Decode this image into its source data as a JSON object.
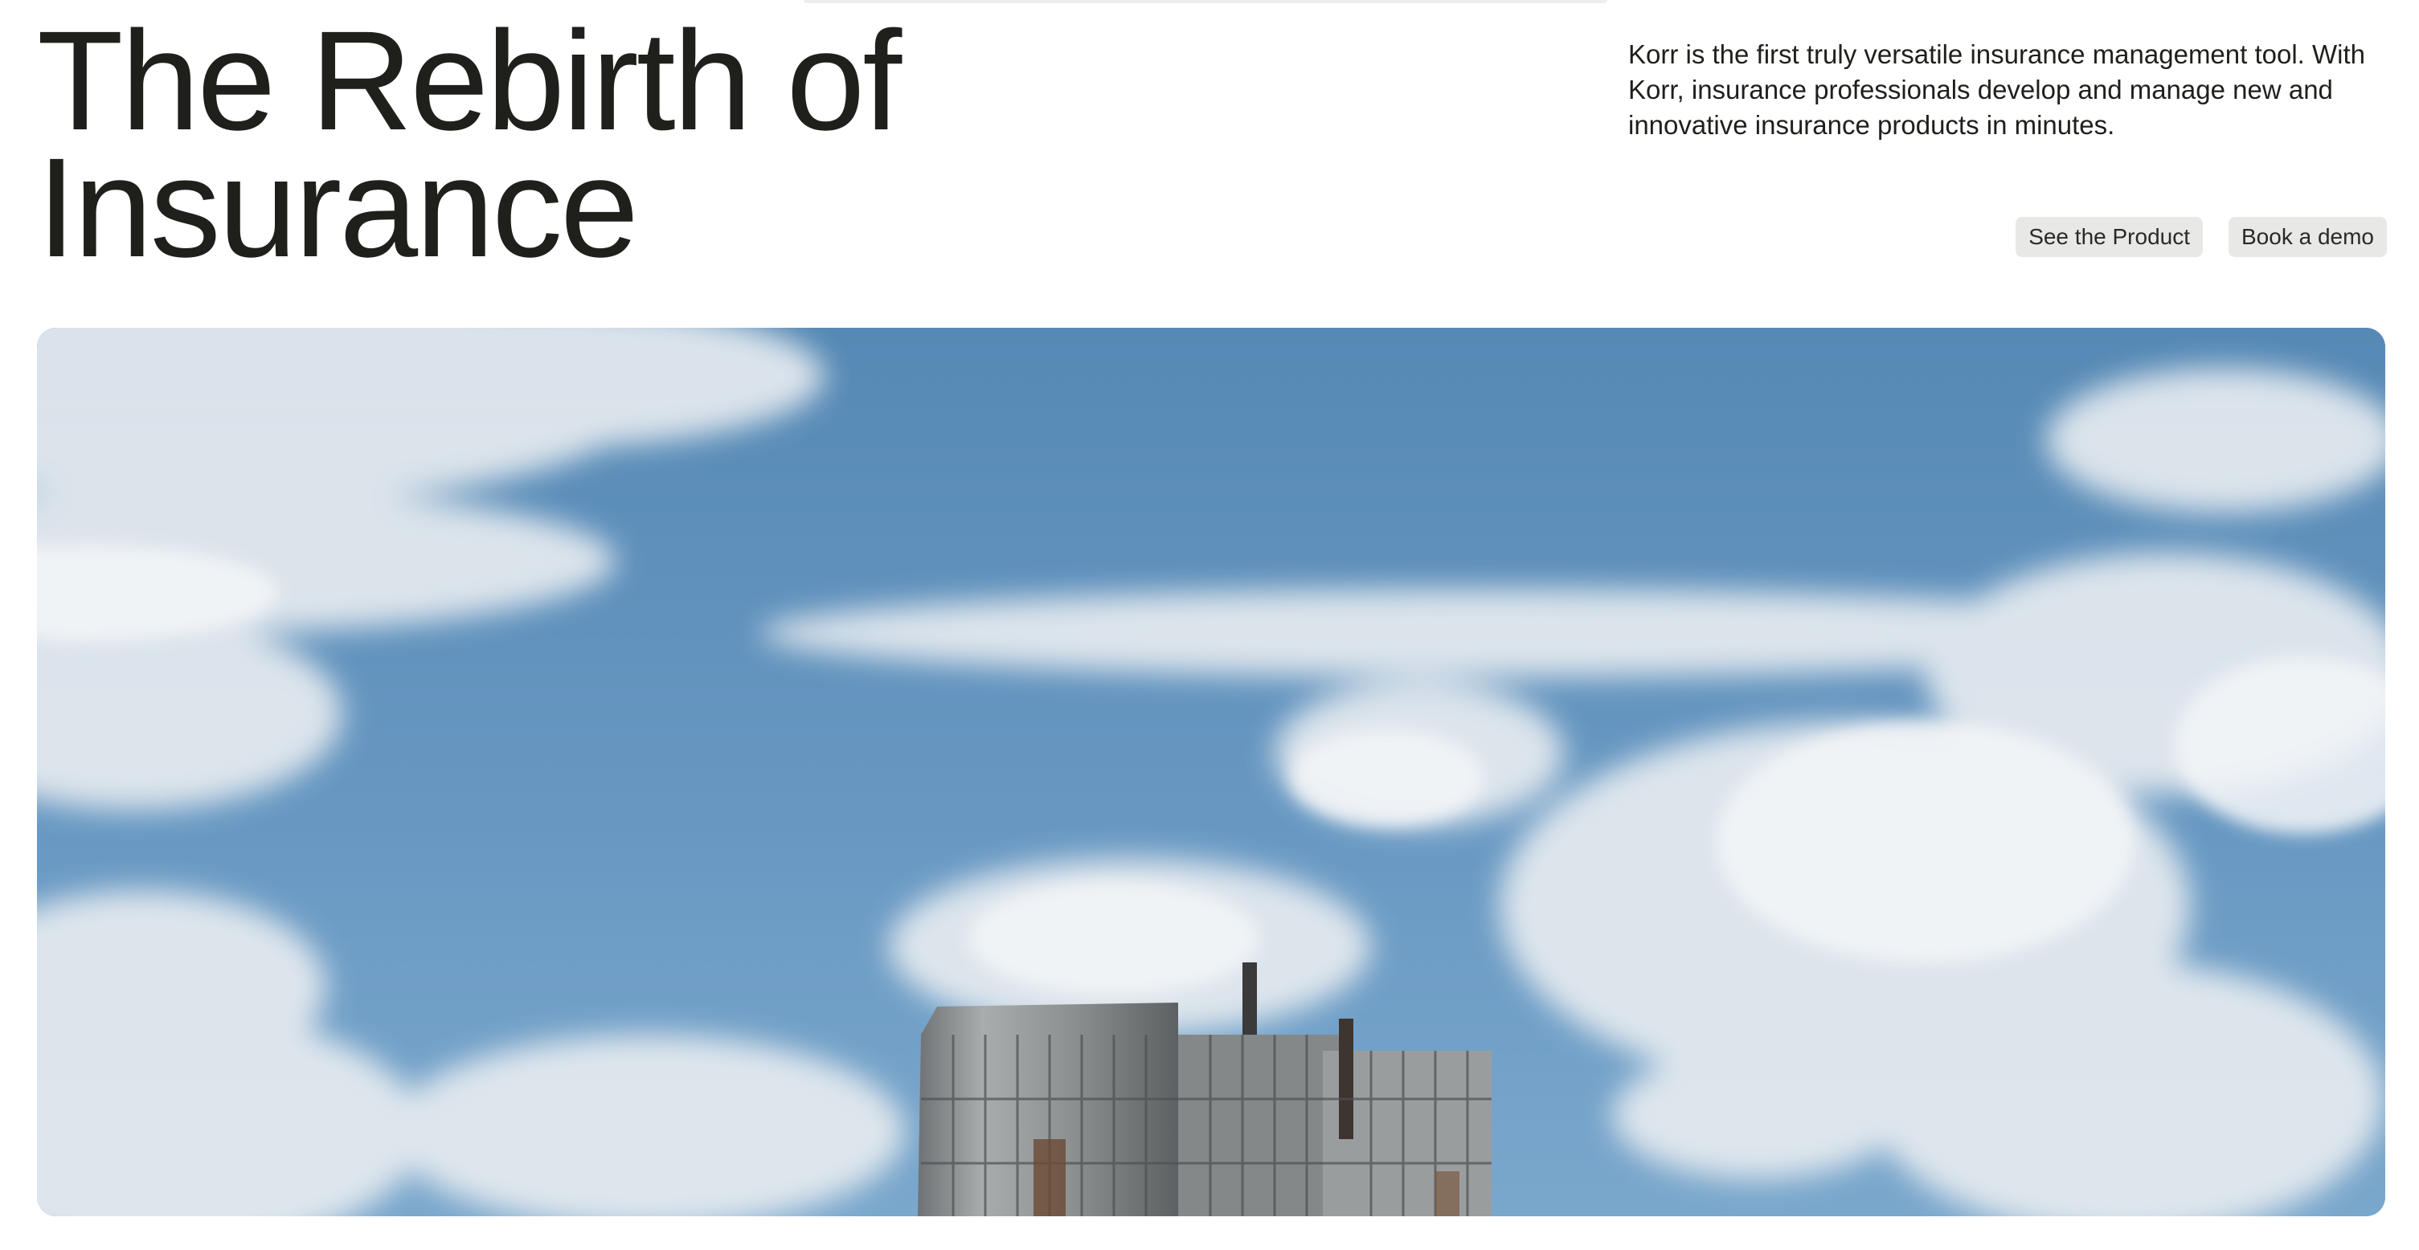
{
  "hero": {
    "headline_line1": "The Rebirth of",
    "headline_line2": "Insurance",
    "intro": "Korr is the first truly versatile insurance management tool. With Korr, insurance professionals develop and manage new and innovative insurance products in minutes."
  },
  "cta": {
    "primary_label": "See the Product",
    "secondary_label": "Book a demo"
  },
  "colors": {
    "text": "#1f1f1c",
    "button_bg": "#e8e8e6",
    "sky": "#5a8db8"
  }
}
